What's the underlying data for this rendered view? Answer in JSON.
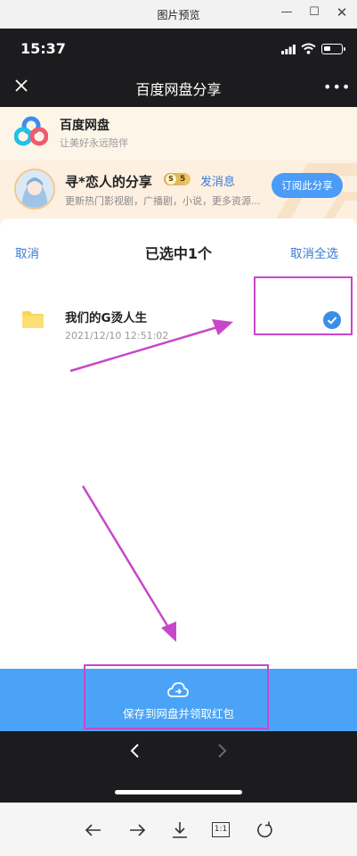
{
  "viewer": {
    "title": "图片预览",
    "minimize_icon": "minimize-icon",
    "maximize_icon": "maximize-icon",
    "close_icon": "close-icon",
    "toolbar": {
      "one_to_one_label": "1:1",
      "icons": [
        "arrow-left-icon",
        "arrow-right-icon",
        "download-icon",
        "actual-size-icon",
        "rotate-icon"
      ]
    }
  },
  "status_bar": {
    "time": "15:37"
  },
  "navbar": {
    "title": "百度网盘分享",
    "more": "•••"
  },
  "brand": {
    "name": "百度网盘",
    "slogan": "让美好永远陪伴"
  },
  "share": {
    "sharer_name": "寻*恋人的分享",
    "level_coin": "S",
    "level": "5",
    "send_message": "发消息",
    "description": "更新热门影视剧，广播剧，小说，更多资源...",
    "subscribe_label": "订阅此分享"
  },
  "selection": {
    "cancel": "取消",
    "title": "已选中1个",
    "deselect_all": "取消全选"
  },
  "files": [
    {
      "name": "我们的G烫人生",
      "date": "2021/12/10 12:51:02",
      "selected": true
    }
  ],
  "bottom_action": {
    "label": "保存到网盘并领取红包"
  },
  "colors": {
    "accent": "#3a7bd5",
    "save_bar": "#4aa3f7",
    "annotation": "#c847c8",
    "brand_bar": "#fdf6e8"
  }
}
